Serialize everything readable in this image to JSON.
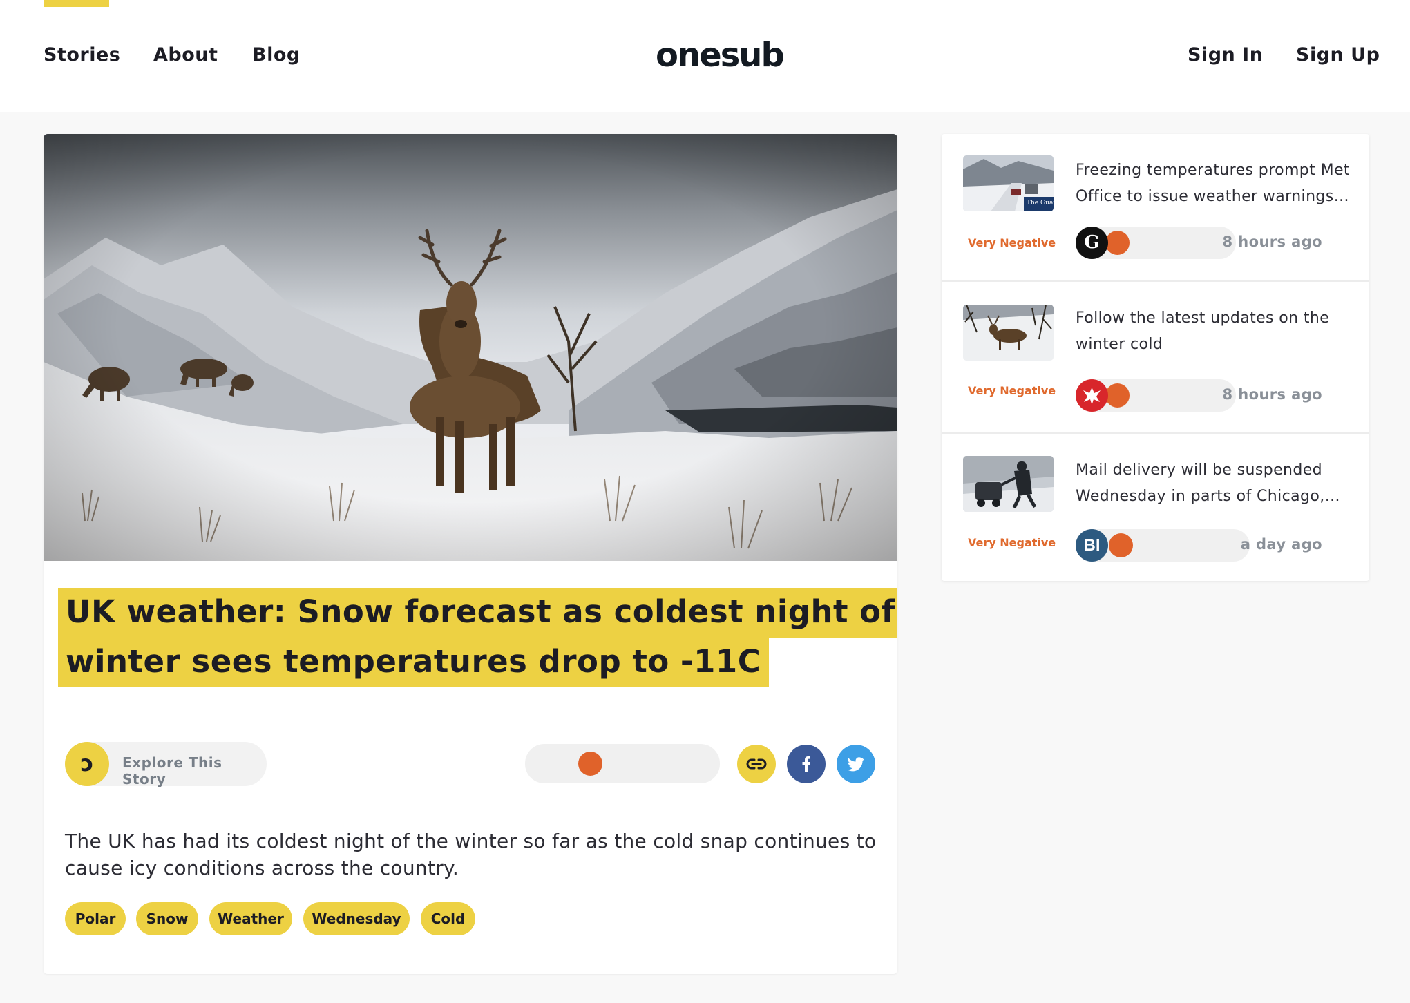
{
  "nav": {
    "links": [
      "Stories",
      "About",
      "Blog"
    ],
    "logo": "onesub",
    "sign_in": "Sign In",
    "sign_up": "Sign Up"
  },
  "article": {
    "title_lines": [
      "UK weather: Snow forecast as coldest night of the",
      "winter sees temperatures drop to -11C"
    ],
    "explore_label": "Explore This Story",
    "explore_icon_glyph": "ɔ",
    "sentiment_level": 0.31,
    "summary": "The UK has had its coldest night of the winter so far as the cold snap continues to cause icy conditions across the country.",
    "tags": [
      "Polar",
      "Snow",
      "Weather",
      "Wednesday",
      "Cold"
    ],
    "share": [
      {
        "name": "link-icon",
        "color": "#edd143"
      },
      {
        "name": "facebook-icon",
        "color": "#3b5998"
      },
      {
        "name": "twitter-icon",
        "color": "#3d9fe6"
      }
    ]
  },
  "sidebar": {
    "items": [
      {
        "title": "Freezing temperatures prompt Met Office to issue weather warnings…",
        "sentiment": "Very Negative",
        "sentiment_level": 0.22,
        "time": "8 hours ago",
        "source_icon": "guardian-icon",
        "source_glyph": "G",
        "source_color": "#111111",
        "thumb_text": "The Guardian"
      },
      {
        "title": "Follow the latest updates on the winter cold",
        "sentiment": "Very Negative",
        "sentiment_level": 0.22,
        "time": "8 hours ago",
        "source_icon": "eagle-icon",
        "source_glyph": "",
        "source_color": "#d8262b"
      },
      {
        "title": "Mail delivery will be suspended Wednesday in parts of Chicago,…",
        "sentiment": "Very Negative",
        "sentiment_level": 0.22,
        "time": "a day ago",
        "source_icon": "business-insider-icon",
        "source_glyph": "BI",
        "source_color": "#2d5a80"
      }
    ]
  },
  "colors": {
    "accent_yellow": "#edd143",
    "sentiment_orange": "#e0622a",
    "sentiment_text": "#e06a2e"
  }
}
